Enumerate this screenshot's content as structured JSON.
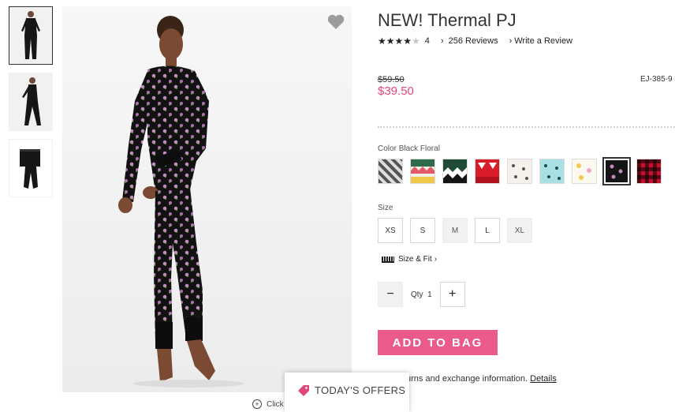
{
  "product": {
    "title": "NEW! Thermal PJ",
    "rating_value": "4",
    "rating_stars": 4,
    "reviews_link": "256 Reviews",
    "write_review_link": "Write a Review",
    "old_price": "$59.50",
    "sale_price": "$39.50",
    "sku": "EJ-385-9"
  },
  "color": {
    "label": "Color",
    "selected": "Black Floral",
    "swatches": [
      "plaid-grey",
      "fairisle-green",
      "fairisle-dark-green",
      "red-pattern",
      "white-print",
      "aqua-print",
      "white-floral",
      "black-floral",
      "red-buffalo-check"
    ]
  },
  "size": {
    "label": "Size",
    "options": [
      {
        "label": "XS",
        "available": true
      },
      {
        "label": "S",
        "available": true
      },
      {
        "label": "M",
        "available": false
      },
      {
        "label": "L",
        "available": true
      },
      {
        "label": "XL",
        "available": false
      }
    ],
    "size_fit_link": "Size & Fit"
  },
  "quantity": {
    "label": "Qty",
    "value": "1",
    "minus": "−",
    "plus": "+"
  },
  "add_to_bag": "ADD TO BAG",
  "returns": {
    "text": "urns and exchange information.",
    "link": "Details"
  },
  "offers": {
    "label": "TODAY'S OFFERS"
  },
  "hint": {
    "text": "Click"
  },
  "colors": {
    "accent": "#ea5a8c",
    "price": "#e2457a"
  },
  "icons": [
    "heart-icon",
    "tag-icon",
    "ruler-icon",
    "zoom-icon",
    "chevron-right-icon",
    "star-icon"
  ]
}
